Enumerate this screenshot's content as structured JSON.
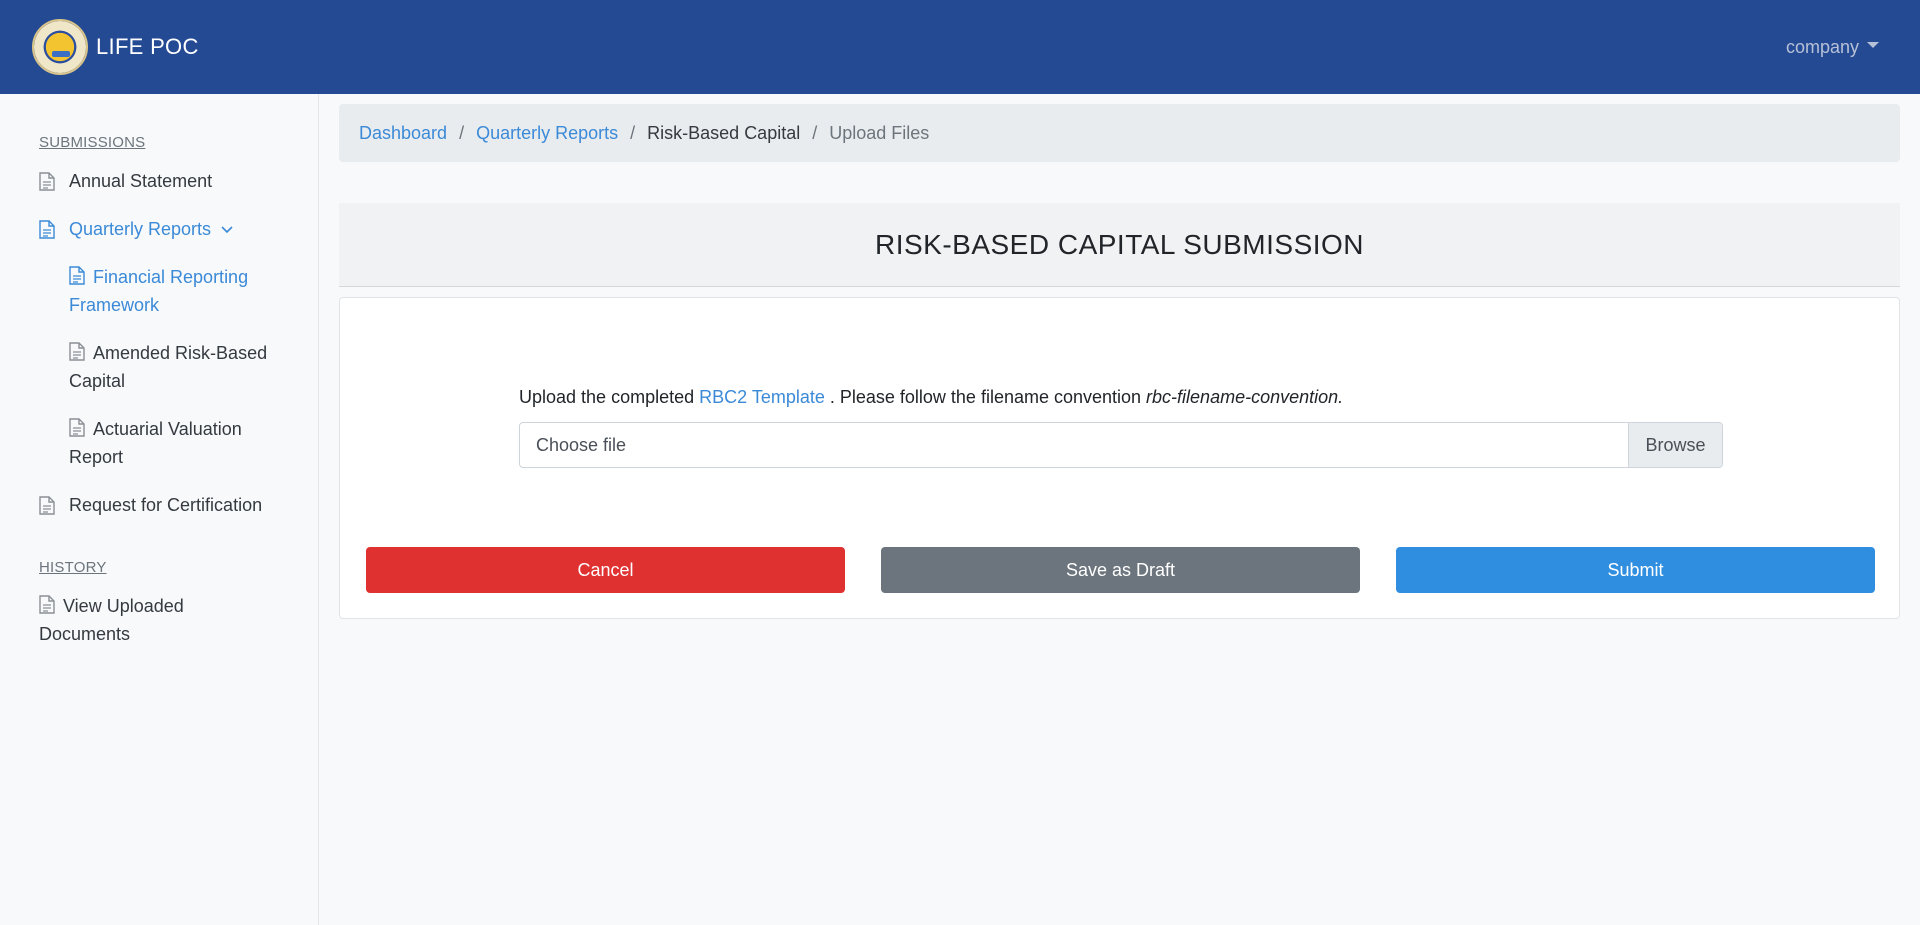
{
  "navbar": {
    "brand_title": "LIFE POC",
    "user_menu_label": "company"
  },
  "sidebar": {
    "submissions_label": "SUBMISSIONS",
    "items": [
      {
        "label": "Annual Statement"
      },
      {
        "label": "Quarterly Reports"
      },
      {
        "label": "Request for Certification"
      }
    ],
    "sub_items": [
      {
        "label": "Financial Reporting Framework"
      },
      {
        "label": "Amended Risk-Based Capital"
      },
      {
        "label": "Actuarial Valuation Report"
      }
    ],
    "history_label": "HISTORY",
    "history_items": [
      {
        "label": "View Uploaded Documents"
      }
    ]
  },
  "breadcrumb": {
    "dashboard": "Dashboard",
    "quarterly_reports": "Quarterly Reports",
    "risk_based_capital": "Risk-Based Capital",
    "current": "Upload Files",
    "separator": "/"
  },
  "card": {
    "title": "RISK-BASED CAPITAL SUBMISSION",
    "instructions_prefix": "Upload the completed ",
    "template_link": "RBC2 Template",
    "instructions_middle": " . Please follow the filename convention ",
    "convention": "rbc-filename-convention.",
    "file_placeholder": "Choose file",
    "browse_label": "Browse"
  },
  "actions": {
    "cancel_label": "Cancel",
    "draft_label": "Save as Draft",
    "submit_label": "Submit"
  },
  "colors": {
    "navbar": "#254a94",
    "link": "#3b8ad8",
    "cancel": "#e03131",
    "draft": "#6c757d",
    "submit": "#2f8ee0"
  }
}
